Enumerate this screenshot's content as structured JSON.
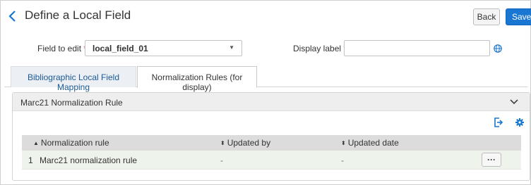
{
  "header": {
    "title": "Define a Local Field",
    "back_label": "Back",
    "save_label": "Save"
  },
  "form": {
    "field_to_edit_label": "Field to edit",
    "field_to_edit_value": "local_field_01",
    "display_label_label": "Display label",
    "display_label_value": "",
    "required_marker": "*"
  },
  "tabs": [
    {
      "label": "Bibliographic Local Field Mapping",
      "active": false
    },
    {
      "label": "Normalization Rules (for display)",
      "active": true
    }
  ],
  "panel": {
    "title": "Marc21 Normalization Rule",
    "table": {
      "columns": [
        "Normalization rule",
        "Updated by",
        "Updated date"
      ],
      "sort_glyphs": [
        "▲",
        "⬍",
        "⬍"
      ],
      "rows": [
        {
          "index": "1",
          "rule": "Marc21 normalization rule",
          "updated_by": "-",
          "updated_date": "-",
          "action": "···"
        }
      ]
    }
  },
  "icons": {
    "back": "chevron-left-icon",
    "caret": "caret-down-icon",
    "globe": "globe-icon",
    "collapse": "chevron-down-icon",
    "export": "export-icon",
    "settings": "gear-icon"
  },
  "colors": {
    "accent": "#1976d2",
    "required": "#d32f2f",
    "active_tab_text": "#1a5a96",
    "row_background": "#eef3ec"
  }
}
